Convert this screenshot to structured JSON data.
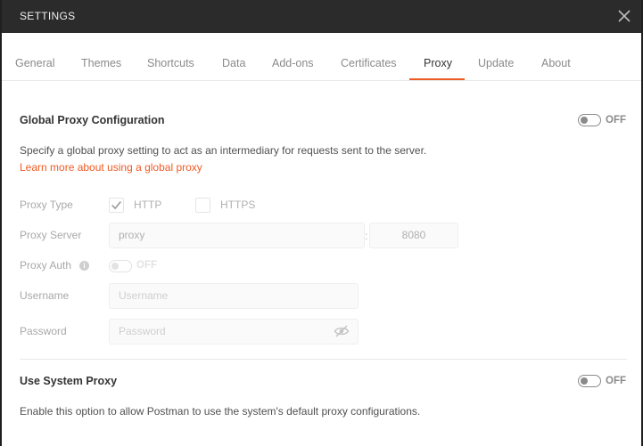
{
  "dialog": {
    "title": "SETTINGS"
  },
  "tabs": [
    "General",
    "Themes",
    "Shortcuts",
    "Data",
    "Add-ons",
    "Certificates",
    "Proxy",
    "Update",
    "About"
  ],
  "active_tab": "Proxy",
  "global_proxy": {
    "title": "Global Proxy Configuration",
    "toggle_label": "OFF",
    "description": "Specify a global proxy setting to act as an intermediary for requests sent to the server.",
    "learn_more": "Learn more about using a global proxy",
    "proxy_type_label": "Proxy Type",
    "http_label": "HTTP",
    "http_checked": true,
    "https_label": "HTTPS",
    "https_checked": false,
    "proxy_server_label": "Proxy Server",
    "proxy_server_value": "proxy",
    "port_value": "8080",
    "proxy_auth_label": "Proxy Auth",
    "proxy_auth_toggle": "OFF",
    "username_label": "Username",
    "username_placeholder": "Username",
    "password_label": "Password",
    "password_placeholder": "Password"
  },
  "system_proxy": {
    "title": "Use System Proxy",
    "toggle_label": "OFF",
    "description": "Enable this option to allow Postman to use the system's default proxy configurations."
  },
  "colors": {
    "accent": "#ef5b25",
    "titlebar": "#2b2b2b"
  }
}
